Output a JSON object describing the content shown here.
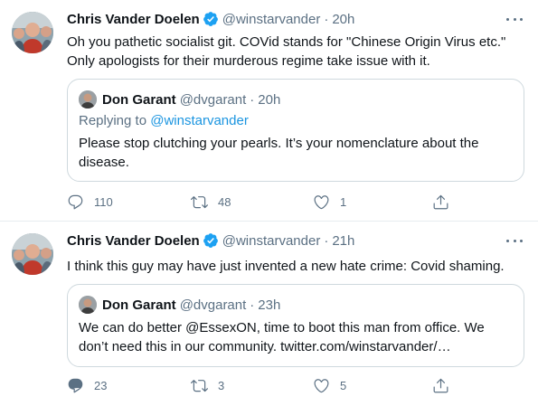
{
  "tweets": [
    {
      "author_name": "Chris Vander Doelen",
      "author_handle": "@winstarvander",
      "separator": "·",
      "time": "20h",
      "text": "Oh you pathetic socialist git. COVid stands for \"Chinese Origin Virus etc.\" Only apologists for their murderous regime take issue with it.",
      "quote": {
        "author_name": "Don Garant",
        "author_handle": "@dvgarant",
        "separator": "·",
        "time": "20h",
        "replying_prefix": "Replying to ",
        "replying_handle": "@winstarvander",
        "text": "Please stop clutching your pearls. It’s your nomenclature about the disease."
      },
      "counts": {
        "replies": "110",
        "retweets": "48",
        "likes": "1"
      }
    },
    {
      "author_name": "Chris Vander Doelen",
      "author_handle": "@winstarvander",
      "separator": "·",
      "time": "21h",
      "text": "I think this guy may have just invented a new hate crime: Covid shaming.",
      "quote": {
        "author_name": "Don Garant",
        "author_handle": "@dvgarant",
        "separator": "·",
        "time": "23h",
        "text": "We can do better @EssexON, time to boot this man from office.  We don’t need this in our community. twitter.com/winstarvander/…"
      },
      "counts": {
        "replies": "23",
        "retweets": "3",
        "likes": "5"
      }
    }
  ],
  "colors": {
    "text": "#0f1419",
    "secondary": "#5b7083",
    "link": "#1b95e0",
    "verified": "#1da1f2",
    "border": "#cfd9de"
  },
  "icons": [
    "verified-badge-icon",
    "more-icon",
    "reply-icon",
    "retweet-icon",
    "like-icon",
    "share-icon"
  ]
}
